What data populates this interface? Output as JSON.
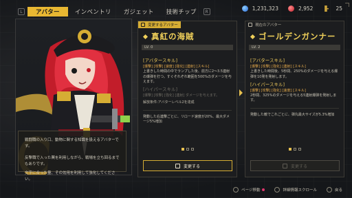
{
  "tabs": {
    "left_key": "L",
    "right_key": "R",
    "items": [
      {
        "label": "アバター",
        "active": true
      },
      {
        "label": "インベントリ",
        "active": false
      },
      {
        "label": "ガジェット",
        "active": false
      },
      {
        "label": "技術チップ",
        "active": false
      }
    ]
  },
  "currency": {
    "gems": "1,231,323",
    "rubies": "2,952",
    "keys": "25"
  },
  "character": {
    "description_1": "戦闘職の入り口、動物に関する知識を扱えるアバターです。",
    "description_2": "反撃職で入った罠を利用しながら、戦場を立ち回るまでもありです。",
    "description_3": "文字に合った量、その効用を利用して強化してください。"
  },
  "card_selected": {
    "tag": "変更するアバター",
    "title": "真紅の海賊",
    "level": "LV. 0",
    "avatar_skill_header": "[アバタースキル]",
    "avatar_skill_tags": "[爆撃] [攻撃] [速度] [強化] [連射] [スキル]",
    "avatar_skill_text": "上書きした時間の中でランプした後、前方に2～3.5連射の爆弾を打つ。すぐそれぞれ範囲を500%のダメージを与えます。",
    "hyper_skill_header": "[ハイパースキル]",
    "hyper_skill_text_dim": "[爆撃] [攻撃] [強化] [連射] ダメージを与えます。",
    "unlock_text": "解放条件:アバターレベル2を達成",
    "passive_text": "発動した右連撃ごとに、リロード速度が20%、最大ダメージ5%増加",
    "change_button": "変更する"
  },
  "card_current": {
    "tag": "現在のアバター",
    "title": "ゴールデンガンナー",
    "level": "LV. 2",
    "avatar_skill_header": "[アバタースキル]",
    "avatar_skill_tags": "[爆撃] [攻撃] [強化] [連射] [スキル]",
    "avatar_skill_text": "上書きした時間後、5秒間、250%のダメージを与える爆弾を10発を発射します。",
    "hyper_skill_header": "[ハイパースキル]",
    "hyper_skill_tags": "[爆撃] [攻撃] [強化] [速度] [スキル]",
    "hyper_skill_text": "2秒間、325%のダメージを与える5連射爆弾を発射します。",
    "passive_text": "発動した敵でこれごとに、弾丸最大サイズが5.3%増加",
    "change_button": "変更する"
  },
  "bottom": {
    "item1": "ページ移動",
    "item2": "詳細情報スクロール",
    "item3": "戻る"
  },
  "colors": {
    "accent": "#e9b832",
    "title": "#f0d05a"
  }
}
